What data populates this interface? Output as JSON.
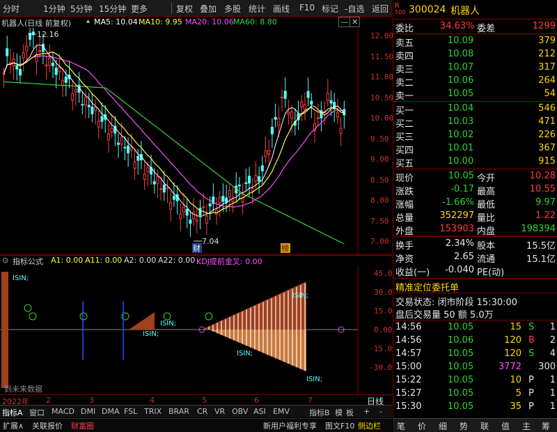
{
  "toolbar": {
    "periods": [
      "分时",
      "1分钟",
      "5分钟",
      "15分钟",
      "更多"
    ],
    "buttons": [
      "复权",
      "叠加",
      "多股",
      "统计",
      "画线",
      "F10",
      "标记",
      "-自选",
      "返回"
    ]
  },
  "chart": {
    "title": "机器人(日线 前复权)",
    "ma5": "MA5: 10.04",
    "ma10": "MA10: 9.95",
    "ma20": "MA20: 10.06",
    "ma60": "MA60: 8.80",
    "high_label": "12.16",
    "low_label": "7.04",
    "marker_cai": "财",
    "marker_bang": "榜",
    "price_ticks": [
      "12.00",
      "11.50",
      "11.00",
      "10.50",
      "10.00",
      "9.50",
      "9.00",
      "8.50",
      "8.00",
      "7.50",
      "7.00"
    ]
  },
  "indicator": {
    "name": "指标公式",
    "a1": "A1: 0.00",
    "a11": "A11: 0.00",
    "a2": "A2: 0.00",
    "a22": "A22: 0.00",
    "kdj": "KDJ提前金叉: 0.00",
    "ticks": [
      "45.00",
      "30.00",
      "15.00",
      "0.00",
      "-15.00",
      "-30.00"
    ],
    "future_label": "到未来数据",
    "isin": "ISIN;"
  },
  "timeaxis": {
    "year": "2022年",
    "months": [
      "2",
      "3",
      "4",
      "5",
      "6",
      "7"
    ],
    "period": "日线"
  },
  "tabs": [
    "指标A",
    "窗口",
    "MACD",
    "DMI",
    "DMA",
    "FSL",
    "TRIX",
    "BRAR",
    "CR",
    "VR",
    "OBV",
    "ASI",
    "EMV",
    "指标B",
    "模",
    "板",
    "+",
    "-"
  ],
  "status": {
    "items": [
      "扩展∧",
      "关联报价",
      "财富圈"
    ],
    "right": [
      "新用户福利专享",
      "图文F10",
      "侧边栏"
    ]
  },
  "stock": {
    "code": "300024",
    "name": "机器人",
    "badge_top": "R",
    "badge_bot": "500"
  },
  "quote": {
    "weibi_label": "委比",
    "weibi": "34.63%",
    "weicha_label": "委差",
    "weicha": "1299",
    "asks": [
      {
        "label": "卖五",
        "price": "10.09",
        "vol": "379"
      },
      {
        "label": "卖四",
        "price": "10.08",
        "vol": "212"
      },
      {
        "label": "卖三",
        "price": "10.07",
        "vol": "317"
      },
      {
        "label": "卖二",
        "price": "10.06",
        "vol": "264"
      },
      {
        "label": "卖一",
        "price": "10.05",
        "vol": "54"
      }
    ],
    "bids": [
      {
        "label": "买一",
        "price": "10.04",
        "vol": "546"
      },
      {
        "label": "买二",
        "price": "10.03",
        "vol": "471"
      },
      {
        "label": "买三",
        "price": "10.02",
        "vol": "226"
      },
      {
        "label": "买四",
        "price": "10.01",
        "vol": "367"
      },
      {
        "label": "买五",
        "price": "10.00",
        "vol": "915"
      }
    ],
    "stats": [
      {
        "l1": "现价",
        "v1": "10.05",
        "c1": "grn",
        "l2": "今开",
        "v2": "10.28",
        "c2": "red"
      },
      {
        "l1": "涨跌",
        "v1": "-0.17",
        "c1": "grn",
        "l2": "最高",
        "v2": "10.55",
        "c2": "red"
      },
      {
        "l1": "涨幅",
        "v1": "-1.66%",
        "c1": "grn",
        "l2": "最低",
        "v2": "9.97",
        "c2": "grn"
      },
      {
        "l1": "总量",
        "v1": "352297",
        "c1": "yel",
        "l2": "量比",
        "v2": "1.22",
        "c2": "red"
      },
      {
        "l1": "外盘",
        "v1": "153903",
        "c1": "red",
        "l2": "内盘",
        "v2": "198394",
        "c2": "grn"
      }
    ],
    "stats2": [
      {
        "l1": "换手",
        "v1": "2.34%",
        "l2": "股本",
        "v2": "15.5亿"
      },
      {
        "l1": "净资",
        "v1": "2.65",
        "l2": "流通",
        "v2": "15.1亿"
      },
      {
        "l1": "收益(一)",
        "v1": "-0.040",
        "l2": "PE(动)",
        "v2": ""
      }
    ],
    "order_title": "精准定位委托单",
    "trade_state": "交易状态: 闭市阶段 15:30:00",
    "after_vol": "盘后交易量 50 额 5.0万",
    "trades": [
      {
        "t": "14:56",
        "p": "10.05",
        "v": "15",
        "s": "S",
        "n": "1",
        "vc": "yel",
        "sc": "grn"
      },
      {
        "t": "14:56",
        "p": "10.06",
        "v": "120",
        "s": "B",
        "n": "2",
        "vc": "yel",
        "sc": "red"
      },
      {
        "t": "14:57",
        "p": "10.05",
        "v": "120",
        "s": "S",
        "n": "4",
        "vc": "yel",
        "sc": "grn"
      },
      {
        "t": "15:00",
        "p": "10.05",
        "v": "3772",
        "s": "",
        "n": "300",
        "vc": "mag",
        "sc": "wht"
      },
      {
        "t": "15:22",
        "p": "10.05",
        "v": "10",
        "s": "P",
        "n": "1",
        "vc": "yel",
        "sc": "wht"
      },
      {
        "t": "15:27",
        "p": "10.05",
        "v": "5",
        "s": "P",
        "n": "1",
        "vc": "yel",
        "sc": "wht"
      },
      {
        "t": "15:30",
        "p": "10.05",
        "v": "35",
        "s": "P",
        "n": "1",
        "vc": "yel",
        "sc": "wht"
      }
    ]
  },
  "nav": [
    "笔",
    "价",
    "细",
    "势",
    "联",
    "值",
    "主",
    "筹"
  ]
}
